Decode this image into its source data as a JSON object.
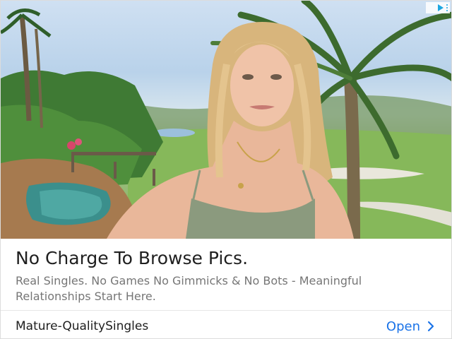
{
  "ad": {
    "image_alt": "Photo of a woman in front of a tropical garden, pool and golf course",
    "headline": "No Charge To Browse Pics.",
    "description": "Real Singles. No Games No Gimmicks & No Bots - Meaningful Relationships Start Here.",
    "advertiser": "Mature-QualitySingles",
    "cta_label": "Open"
  },
  "icons": {
    "adchoices": "adchoices-icon",
    "cta_chevron": "chevron-right-icon"
  },
  "colors": {
    "headline": "#202020",
    "description": "#767676",
    "cta": "#1a73e8",
    "adchoices": "#1ea7e1"
  }
}
